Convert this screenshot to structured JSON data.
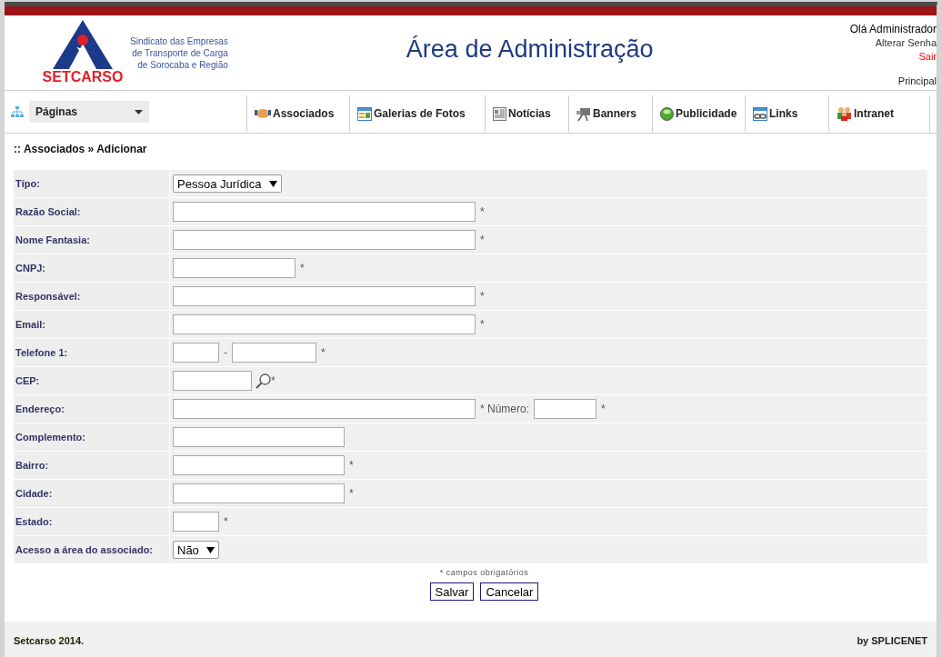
{
  "header": {
    "logo_text": "SETCARSO",
    "org_lines": [
      "Sindicato das Empresas",
      "de Transporte de Carga",
      "de Sorocaba e Região"
    ],
    "title": "Área de Administração",
    "greeting": "Olá Administrador",
    "change_password": "Alterar Senha",
    "logout": "Sair",
    "home": "Principal"
  },
  "nav": {
    "pages_menu": "Páginas",
    "items": [
      {
        "label": "Associados"
      },
      {
        "label": "Galerias de Fotos"
      },
      {
        "label": "Notícias"
      },
      {
        "label": "Banners"
      },
      {
        "label": "Publicidade"
      },
      {
        "label": "Links"
      },
      {
        "label": "Intranet"
      }
    ]
  },
  "breadcrumb": ":: Associados » Adicionar",
  "form": {
    "rows": [
      {
        "label": "Típo:",
        "parts": [
          {
            "kind": "select",
            "value": "Pessoa Jurídica"
          }
        ]
      },
      {
        "label": "Razão Social:",
        "parts": [
          {
            "kind": "input"
          },
          {
            "kind": "text",
            "text": "*"
          }
        ]
      },
      {
        "label": "Nome Fantasia:",
        "parts": [
          {
            "kind": "input"
          },
          {
            "kind": "text",
            "text": "*"
          }
        ]
      },
      {
        "label": "CNPJ:",
        "parts": [
          {
            "kind": "input"
          },
          {
            "kind": "text",
            "text": "*"
          }
        ]
      },
      {
        "label": "Responsável:",
        "parts": [
          {
            "kind": "input"
          },
          {
            "kind": "text",
            "text": "*"
          }
        ]
      },
      {
        "label": "Email:",
        "parts": [
          {
            "kind": "input"
          },
          {
            "kind": "text",
            "text": "*"
          }
        ]
      },
      {
        "label": "Telefone 1:",
        "parts": [
          {
            "kind": "input"
          },
          {
            "kind": "text",
            "text": "-"
          },
          {
            "kind": "input"
          },
          {
            "kind": "text",
            "text": "*"
          }
        ]
      },
      {
        "label": "CEP:",
        "parts": [
          {
            "kind": "input"
          },
          {
            "kind": "search"
          },
          {
            "kind": "text",
            "text": "*"
          }
        ]
      },
      {
        "label": "Endereço:",
        "parts": [
          {
            "kind": "input"
          },
          {
            "kind": "text",
            "text": "* Número:"
          },
          {
            "kind": "input"
          },
          {
            "kind": "text",
            "text": "*"
          }
        ]
      },
      {
        "label": "Complemento:",
        "parts": [
          {
            "kind": "input"
          }
        ]
      },
      {
        "label": "Bairro:",
        "parts": [
          {
            "kind": "input"
          },
          {
            "kind": "text",
            "text": "*"
          }
        ]
      },
      {
        "label": "Cidade:",
        "parts": [
          {
            "kind": "input"
          },
          {
            "kind": "text",
            "text": "*"
          }
        ]
      },
      {
        "label": "Estado:",
        "parts": [
          {
            "kind": "input"
          },
          {
            "kind": "text",
            "text": "*"
          }
        ]
      },
      {
        "label": "Acesso a área do associado:",
        "parts": [
          {
            "kind": "select",
            "value": "Não"
          }
        ]
      }
    ],
    "required_note": "* campos obrigatórios",
    "buttons": [
      "Salvar",
      "Cancelar"
    ]
  },
  "footer": {
    "left": "Setcarso 2014.",
    "right": "by SPLICENET"
  }
}
